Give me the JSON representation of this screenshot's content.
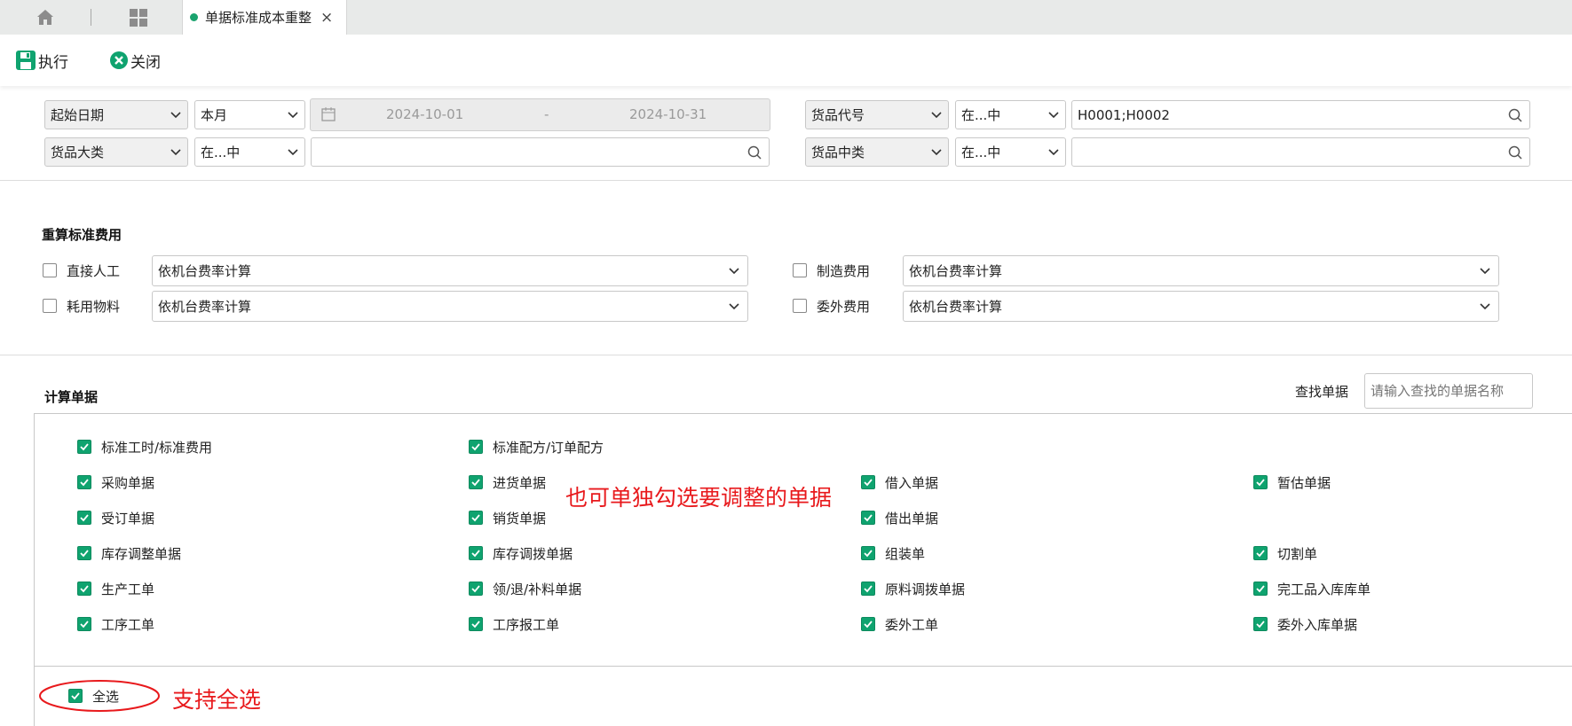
{
  "tabbar": {
    "home_icon": "home-icon",
    "apps_icon": "apps-grid-icon",
    "active_tab": {
      "label": "单据标准成本重整",
      "close": "×"
    }
  },
  "toolbar": {
    "execute_label": "执行",
    "close_label": "关闭"
  },
  "filters": {
    "row1": {
      "field1": "起始日期",
      "op1": "本月",
      "date_from": "2024-10-01",
      "date_sep": "-",
      "date_to": "2024-10-31",
      "field2": "货品代号",
      "op2": "在...中",
      "value2": "H0001;H0002"
    },
    "row2": {
      "field1": "货品大类",
      "op1": "在...中",
      "value1": "",
      "field2": "货品中类",
      "op2": "在...中",
      "value2": ""
    }
  },
  "recalc": {
    "title": "重算标准费用",
    "items": [
      {
        "label": "直接人工",
        "checked": false,
        "method": "依机台费率计算"
      },
      {
        "label": "制造费用",
        "checked": false,
        "method": "依机台费率计算"
      },
      {
        "label": "耗用物料",
        "checked": false,
        "method": "依机台费率计算"
      },
      {
        "label": "委外费用",
        "checked": false,
        "method": "依机台费率计算"
      }
    ]
  },
  "docs": {
    "title": "计算单据",
    "search_label": "查找单据",
    "search_placeholder": "请输入查找的单据名称",
    "items": [
      {
        "label": "标准工时/标准费用",
        "checked": true
      },
      {
        "label": "标准配方/订单配方",
        "checked": true
      },
      {
        "label": "采购单据",
        "checked": true
      },
      {
        "label": "进货单据",
        "checked": true
      },
      {
        "label": "借入单据",
        "checked": true
      },
      {
        "label": "暂估单据",
        "checked": true
      },
      {
        "label": "受订单据",
        "checked": true
      },
      {
        "label": "销货单据",
        "checked": true
      },
      {
        "label": "借出单据",
        "checked": true
      },
      {
        "label": "库存调整单据",
        "checked": true
      },
      {
        "label": "库存调拨单据",
        "checked": true
      },
      {
        "label": "组装单",
        "checked": true
      },
      {
        "label": "切割单",
        "checked": true
      },
      {
        "label": "生产工单",
        "checked": true
      },
      {
        "label": "领/退/补料单据",
        "checked": true
      },
      {
        "label": "原料调拨单据",
        "checked": true
      },
      {
        "label": "完工品入库库单",
        "checked": true
      },
      {
        "label": "工序工单",
        "checked": true
      },
      {
        "label": "工序报工单",
        "checked": true
      },
      {
        "label": "委外工单",
        "checked": true
      },
      {
        "label": "委外入库单据",
        "checked": true
      }
    ],
    "select_all": {
      "label": "全选",
      "checked": true
    }
  },
  "annotations": {
    "individual": "也可单独勾选要调整的单据",
    "select_all": "支持全选"
  },
  "colors": {
    "accent": "#0fa36f",
    "annotation": "#e8191c"
  }
}
